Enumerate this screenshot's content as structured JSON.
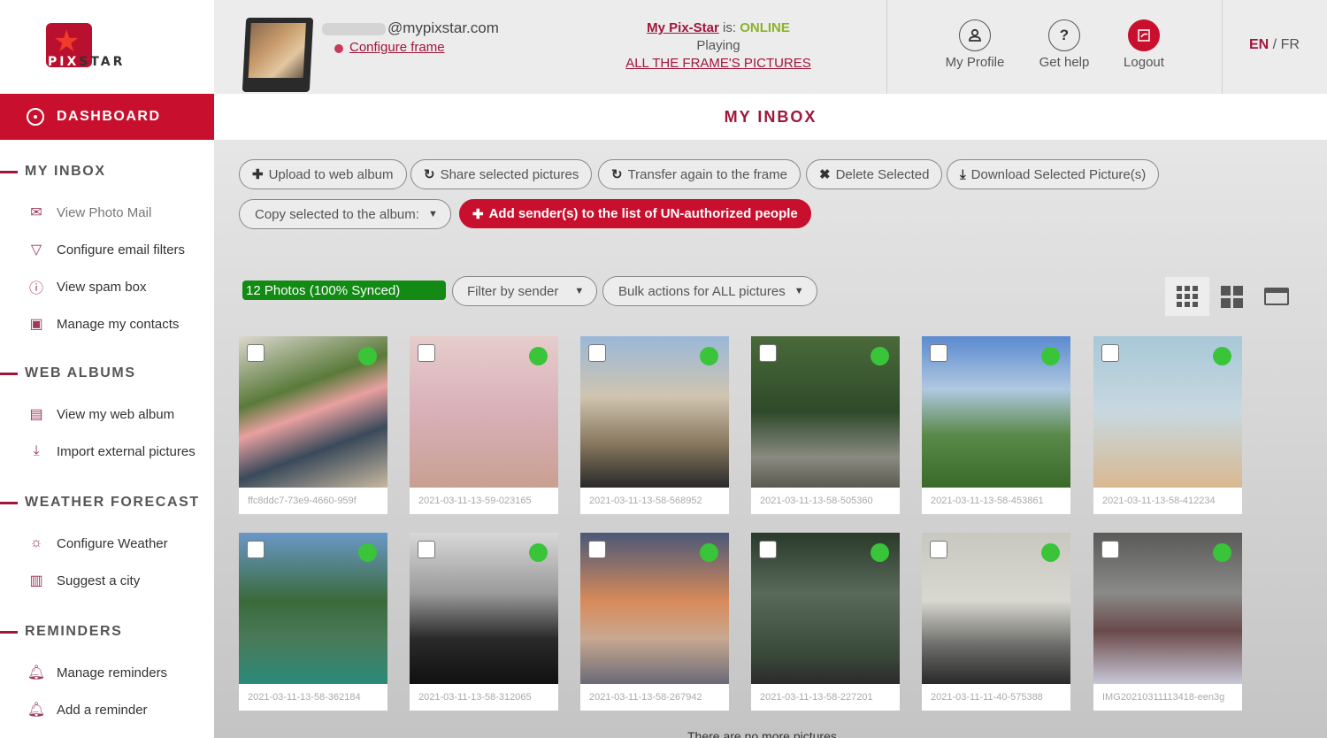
{
  "brand": {
    "pix": "PIX",
    "star": "STAR",
    "accent": "#c8102e"
  },
  "sidebar": {
    "dashboard": "DASHBOARD",
    "sections": [
      {
        "title": "MY INBOX",
        "items": [
          {
            "label": "View Photo Mail",
            "icon": "envelope-icon"
          },
          {
            "label": "Configure email filters",
            "icon": "filter-icon"
          },
          {
            "label": "View spam box",
            "icon": "alert-icon"
          },
          {
            "label": "Manage my contacts",
            "icon": "contacts-icon"
          }
        ]
      },
      {
        "title": "WEB ALBUMS",
        "items": [
          {
            "label": "View my web album",
            "icon": "album-icon"
          },
          {
            "label": "Import external pictures",
            "icon": "import-icon"
          }
        ]
      },
      {
        "title": "WEATHER FORECAST",
        "items": [
          {
            "label": "Configure Weather",
            "icon": "weather-icon"
          },
          {
            "label": "Suggest a city",
            "icon": "city-icon"
          }
        ]
      },
      {
        "title": "REMINDERS",
        "items": [
          {
            "label": "Manage reminders",
            "icon": "bell-icon"
          },
          {
            "label": "Add a reminder",
            "icon": "bell-plus-icon"
          }
        ]
      }
    ]
  },
  "header": {
    "email_domain": "@mypixstar.com",
    "configure_frame": "Configure frame",
    "status_link": "My Pix-Star",
    "status_is": " is: ",
    "status_value": "ONLINE",
    "playing": "Playing",
    "playing_link": "ALL THE FRAME'S PICTURES",
    "my_profile": "My Profile",
    "get_help": "Get help",
    "logout": "Logout",
    "help_glyph": "?",
    "lang_en": "EN",
    "lang_sep": " / ",
    "lang_fr": "FR"
  },
  "page_title": "MY INBOX",
  "toolbar": {
    "upload": "Upload to web album",
    "share": "Share selected pictures",
    "transfer": "Transfer again to the frame",
    "delete": "Delete Selected",
    "download": "Download Selected Picture(s)",
    "copy_album": "Copy selected to the album:",
    "add_sender": "Add sender(s) to the list of UN-authorized people"
  },
  "filters": {
    "sync_status": "12 Photos (100% Synced)",
    "filter_sender": "Filter by sender",
    "bulk_actions": "Bulk actions for ALL pictures"
  },
  "photos": [
    {
      "name": "ffc8ddc7-73e9-4660-959f",
      "synced": true
    },
    {
      "name": "2021-03-11-13-59-023165",
      "synced": true
    },
    {
      "name": "2021-03-11-13-58-568952",
      "synced": true
    },
    {
      "name": "2021-03-11-13-58-505360",
      "synced": true
    },
    {
      "name": "2021-03-11-13-58-453861",
      "synced": true
    },
    {
      "name": "2021-03-11-13-58-412234",
      "synced": true
    },
    {
      "name": "2021-03-11-13-58-362184",
      "synced": true
    },
    {
      "name": "2021-03-11-13-58-312065",
      "synced": true
    },
    {
      "name": "2021-03-11-13-58-267942",
      "synced": true
    },
    {
      "name": "2021-03-11-13-58-227201",
      "synced": true
    },
    {
      "name": "2021-03-11-11-40-575388",
      "synced": true
    },
    {
      "name": "IMG20210311113418-een3g",
      "synced": true
    }
  ],
  "footer_text": "There are no more pictures"
}
